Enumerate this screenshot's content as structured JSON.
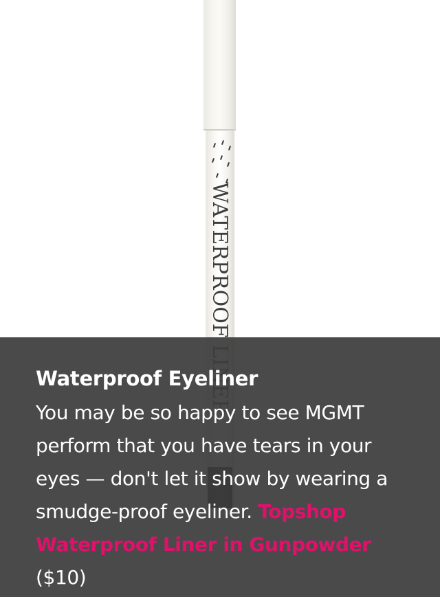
{
  "product_image": {
    "label": "WATERPROOF LINER",
    "alt": "Waterproof eyeliner pencil"
  },
  "caption": {
    "title": "Waterproof Eyeliner",
    "body_text": "You may be so happy to see MGMT perform that you have tears in your eyes — don't let it show by wearing a smudge-proof eyeliner.",
    "link_text": "Topshop Waterproof Liner in Gunpowder",
    "price": "($10)"
  },
  "colors": {
    "overlay": "#3c3c3c",
    "link": "#e0116b",
    "text": "#ffffff"
  }
}
